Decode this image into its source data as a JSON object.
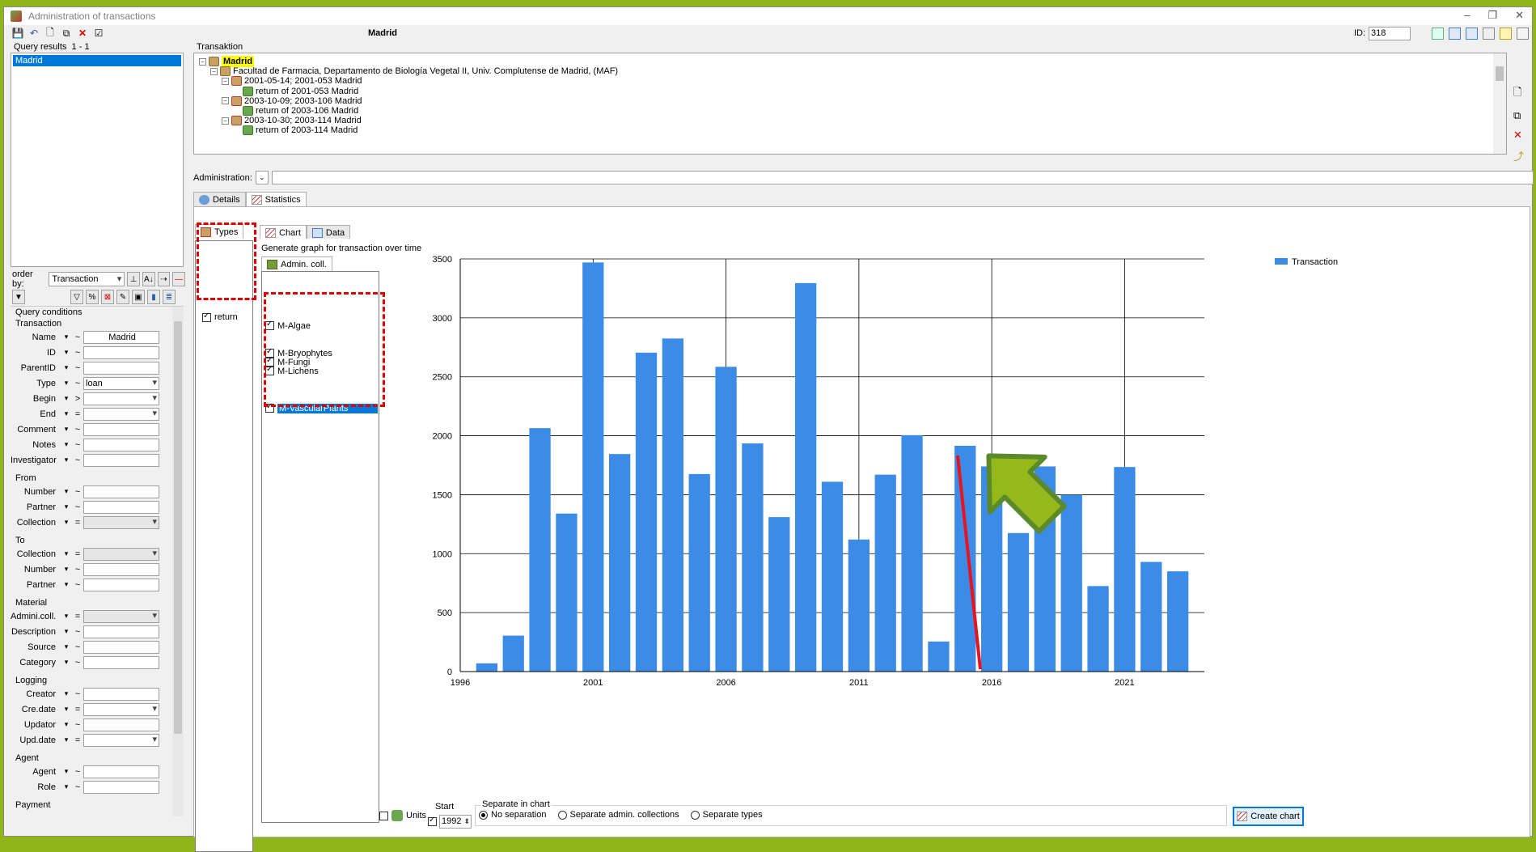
{
  "window": {
    "title": "Administration of transactions"
  },
  "query_results": {
    "label": "Query results",
    "count": "1 - 1",
    "items": [
      "Madrid"
    ]
  },
  "orderby": {
    "label": "order by:",
    "value": "Transaction"
  },
  "query_conditions": {
    "title": "Query conditions",
    "groups": [
      {
        "name": "Transaction",
        "rows": [
          {
            "label": "Name",
            "op": "~",
            "value": "Madrid"
          },
          {
            "label": "ID",
            "op": "~",
            "value": ""
          },
          {
            "label": "ParentID",
            "op": "~",
            "value": ""
          },
          {
            "label": "Type",
            "op": "~",
            "value": "loan"
          },
          {
            "label": "Begin",
            "op": ">",
            "value": ""
          },
          {
            "label": "End",
            "op": "=",
            "value": ""
          },
          {
            "label": "Comment",
            "op": "~",
            "value": ""
          },
          {
            "label": "Notes",
            "op": "~",
            "value": ""
          },
          {
            "label": "Investigator",
            "op": "~",
            "value": ""
          }
        ]
      },
      {
        "name": "From",
        "rows": [
          {
            "label": "Number",
            "op": "~",
            "value": ""
          },
          {
            "label": "Partner",
            "op": "~",
            "value": ""
          },
          {
            "label": "Collection",
            "op": "=",
            "value": ""
          }
        ]
      },
      {
        "name": "To",
        "rows": [
          {
            "label": "Collection",
            "op": "=",
            "value": ""
          },
          {
            "label": "Number",
            "op": "~",
            "value": ""
          },
          {
            "label": "Partner",
            "op": "~",
            "value": ""
          }
        ]
      },
      {
        "name": "Material",
        "rows": [
          {
            "label": "Admini.coll.",
            "op": "=",
            "value": ""
          },
          {
            "label": "Description",
            "op": "~",
            "value": ""
          },
          {
            "label": "Source",
            "op": "~",
            "value": ""
          },
          {
            "label": "Category",
            "op": "~",
            "value": ""
          }
        ]
      },
      {
        "name": "Logging",
        "rows": [
          {
            "label": "Creator",
            "op": "~",
            "value": ""
          },
          {
            "label": "Cre.date",
            "op": "=",
            "value": ""
          },
          {
            "label": "Updator",
            "op": "~",
            "value": ""
          },
          {
            "label": "Upd.date",
            "op": "=",
            "value": ""
          }
        ]
      },
      {
        "name": "Agent",
        "rows": [
          {
            "label": "Agent",
            "op": "~",
            "value": ""
          },
          {
            "label": "Role",
            "op": "~",
            "value": ""
          }
        ]
      },
      {
        "name": "Payment",
        "rows": []
      }
    ]
  },
  "header": {
    "name": "Madrid",
    "id_label": "ID:",
    "id_value": "318"
  },
  "transaktion": {
    "label": "Transaktion",
    "tree": [
      {
        "text": "Madrid",
        "level": 0,
        "highlight": true,
        "icon": "box"
      },
      {
        "text": "Facultad de Farmacia, Departamento de Biología Vegetal II, Univ. Complutense de Madrid, (MAF)",
        "level": 1,
        "icon": "box"
      },
      {
        "text": "2001-05-14; 2001-053 Madrid",
        "level": 2,
        "icon": "warn"
      },
      {
        "text": "return of 2001-053 Madrid",
        "level": 3,
        "icon": "ret"
      },
      {
        "text": "2003-10-09; 2003-106 Madrid",
        "level": 2,
        "icon": "warn"
      },
      {
        "text": "return of 2003-106 Madrid",
        "level": 3,
        "icon": "ret"
      },
      {
        "text": "2003-10-30; 2003-114 Madrid",
        "level": 2,
        "icon": "warn"
      },
      {
        "text": "return of 2003-114 Madrid",
        "level": 3,
        "icon": "ret"
      }
    ]
  },
  "administration": {
    "label": "Administration:"
  },
  "tabs": {
    "details": "Details",
    "statistics": "Statistics",
    "types": "Types",
    "chart": "Chart",
    "data": "Data",
    "admin_coll": "Admin. coll."
  },
  "generate_label": "Generate graph for transaction over time",
  "types_list": [
    {
      "label": "return",
      "checked": true
    }
  ],
  "collections": [
    {
      "label": "M-Algae",
      "checked": true,
      "selected": false
    },
    {
      "label": "M-Bryophytes",
      "checked": true,
      "selected": false
    },
    {
      "label": "M-Fungi",
      "checked": true,
      "selected": false
    },
    {
      "label": "M-Lichens",
      "checked": true,
      "selected": false
    },
    {
      "label": "M-VascularPlants",
      "checked": true,
      "selected": true
    }
  ],
  "bottom": {
    "units_label": "Units",
    "start_label": "Start",
    "start_value": "1992",
    "separate_label": "Separate in chart",
    "options": [
      "No separation",
      "Separate admin. collections",
      "Separate types"
    ],
    "selected_option": 0,
    "create_button": "Create chart"
  },
  "colors": {
    "bar": "#3c8ce7",
    "annotation_line": "#e8131c",
    "arrow_fill": "#95b81a",
    "arrow_stroke": "#5c8a2a",
    "dash": "#e00000"
  },
  "chart_data": {
    "type": "bar",
    "x": [
      1997,
      1998,
      1999,
      2000,
      2001,
      2002,
      2003,
      2004,
      2005,
      2006,
      2007,
      2008,
      2009,
      2010,
      2011,
      2012,
      2013,
      2014,
      2015,
      2016,
      2017,
      2018,
      2019,
      2020,
      2021,
      2022,
      2023
    ],
    "series": [
      {
        "name": "Transaction",
        "values": [
          70,
          305,
          2065,
          1340,
          3470,
          1845,
          2705,
          2825,
          1675,
          2585,
          1935,
          1310,
          3295,
          1610,
          1120,
          1670,
          2005,
          255,
          1915,
          1740,
          1175,
          1740,
          1500,
          725,
          1735,
          930,
          850
        ]
      }
    ],
    "xticks": [
      "1996",
      "2001",
      "2006",
      "2011",
      "2016",
      "2021"
    ],
    "yticks": [
      "0",
      "500",
      "1000",
      "1500",
      "2000",
      "2500",
      "3000",
      "3500"
    ],
    "xlim": [
      1996,
      2024
    ],
    "ylim": [
      0,
      3500
    ],
    "grid": true,
    "legend": "top-right"
  }
}
